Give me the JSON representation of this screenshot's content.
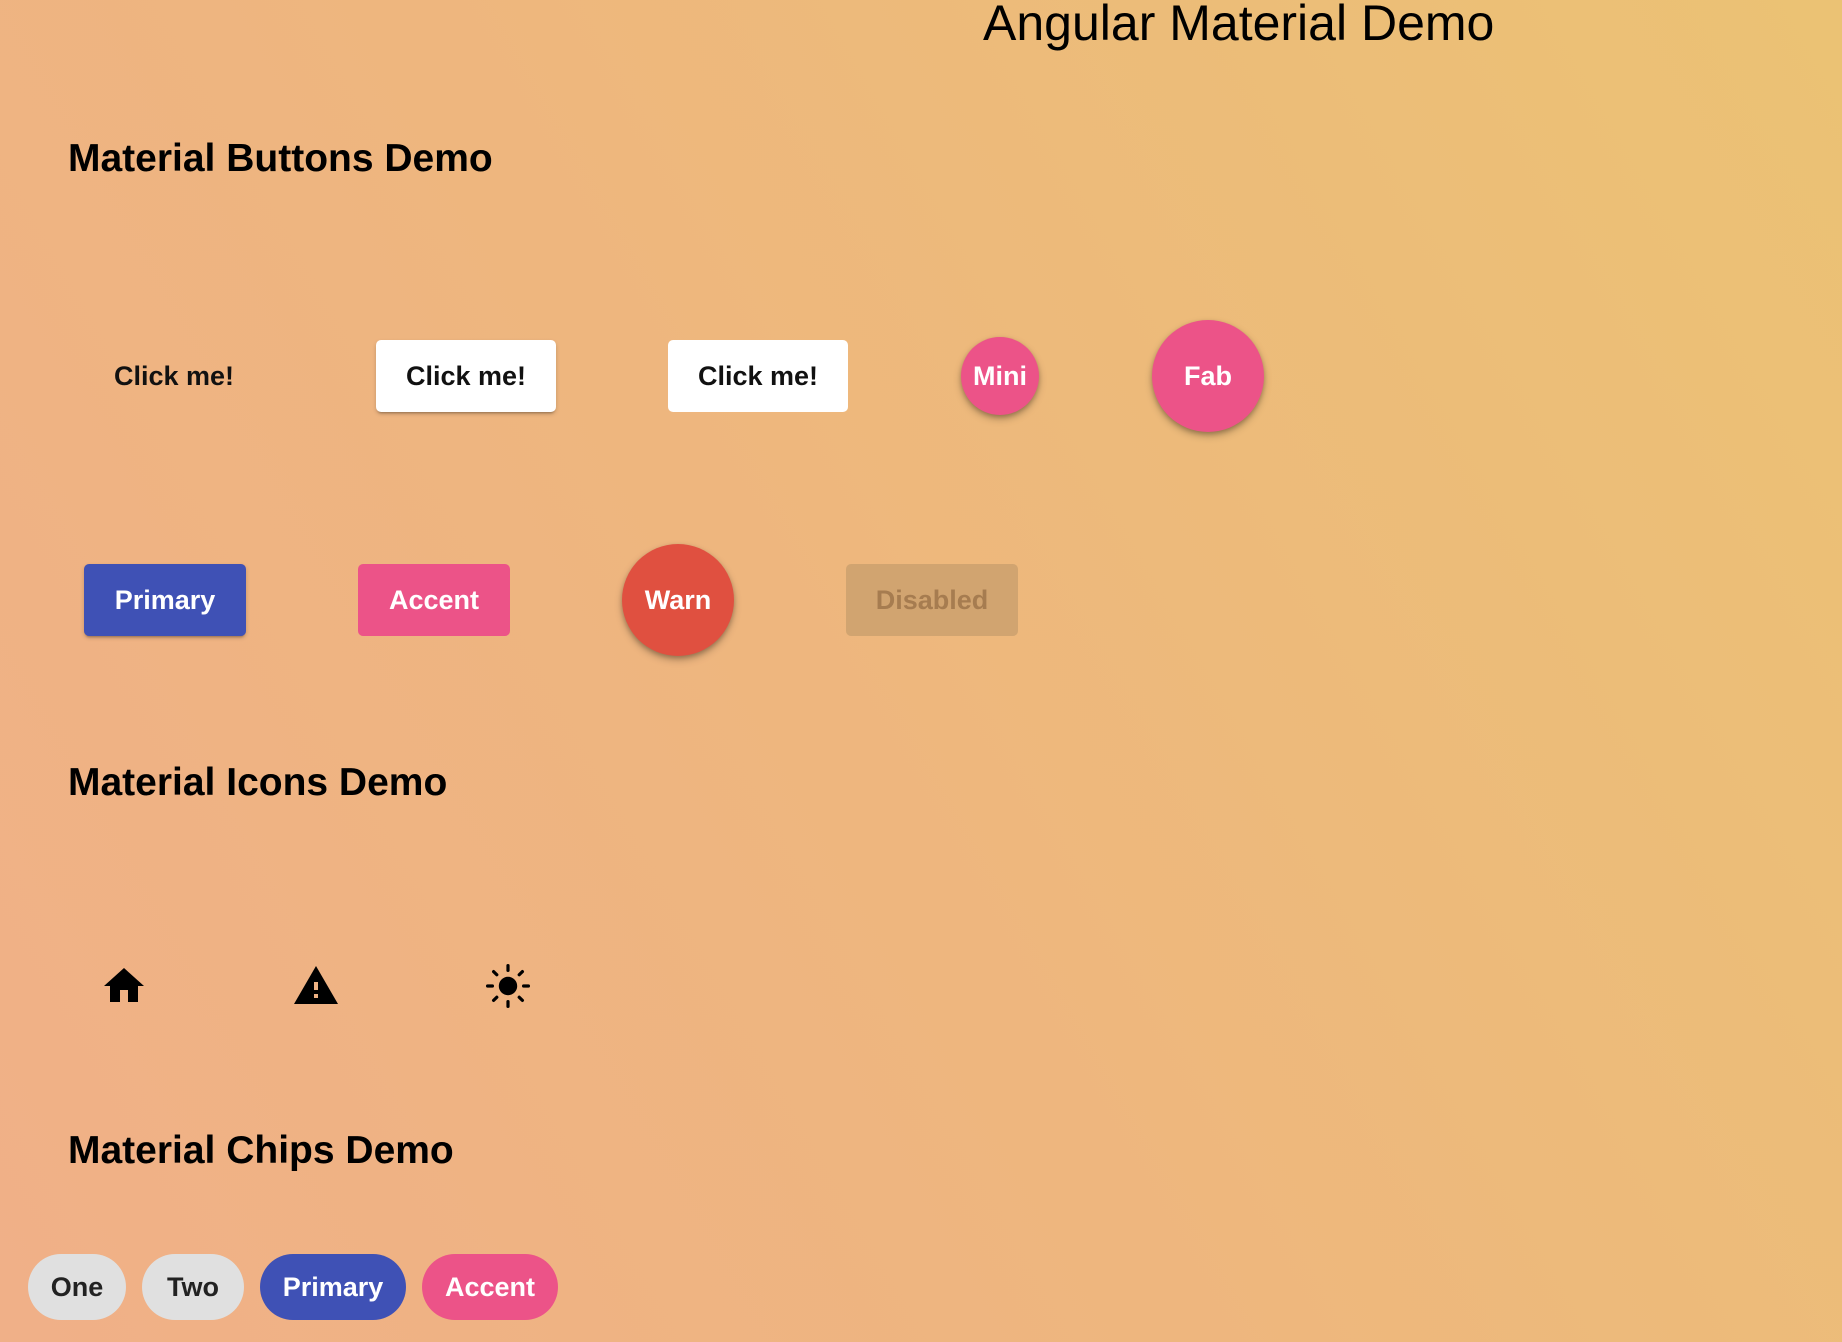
{
  "page": {
    "title": "Angular Material Demo",
    "background_from": "#f0b088",
    "background_to": "#ebc274"
  },
  "buttons_section": {
    "title": "Material Buttons Demo",
    "row1": {
      "basic_label": "Click me!",
      "raised_label": "Click me!",
      "flat_label": "Click me!",
      "mini_fab_label": "Mini",
      "fab_label": "Fab"
    },
    "row2": {
      "primary_label": "Primary",
      "accent_label": "Accent",
      "warn_label": "Warn",
      "disabled_label": "Disabled"
    }
  },
  "icons_section": {
    "title": "Material Icons Demo",
    "icons": [
      "home-icon",
      "warning-icon",
      "brightness-icon"
    ]
  },
  "chips_section": {
    "title": "Material Chips Demo",
    "chips": [
      {
        "label": "One",
        "color": "#e0e0e0"
      },
      {
        "label": "Two",
        "color": "#e0e0e0"
      },
      {
        "label": "Primary",
        "color": "#3f51b5"
      },
      {
        "label": "Accent",
        "color": "#ec5388"
      }
    ]
  },
  "colors": {
    "primary": "#3f51b5",
    "accent": "#ec5388",
    "warn": "#e05040",
    "disabled_bg": "#d1a470",
    "disabled_text": "#a67c50",
    "white": "#ffffff"
  }
}
